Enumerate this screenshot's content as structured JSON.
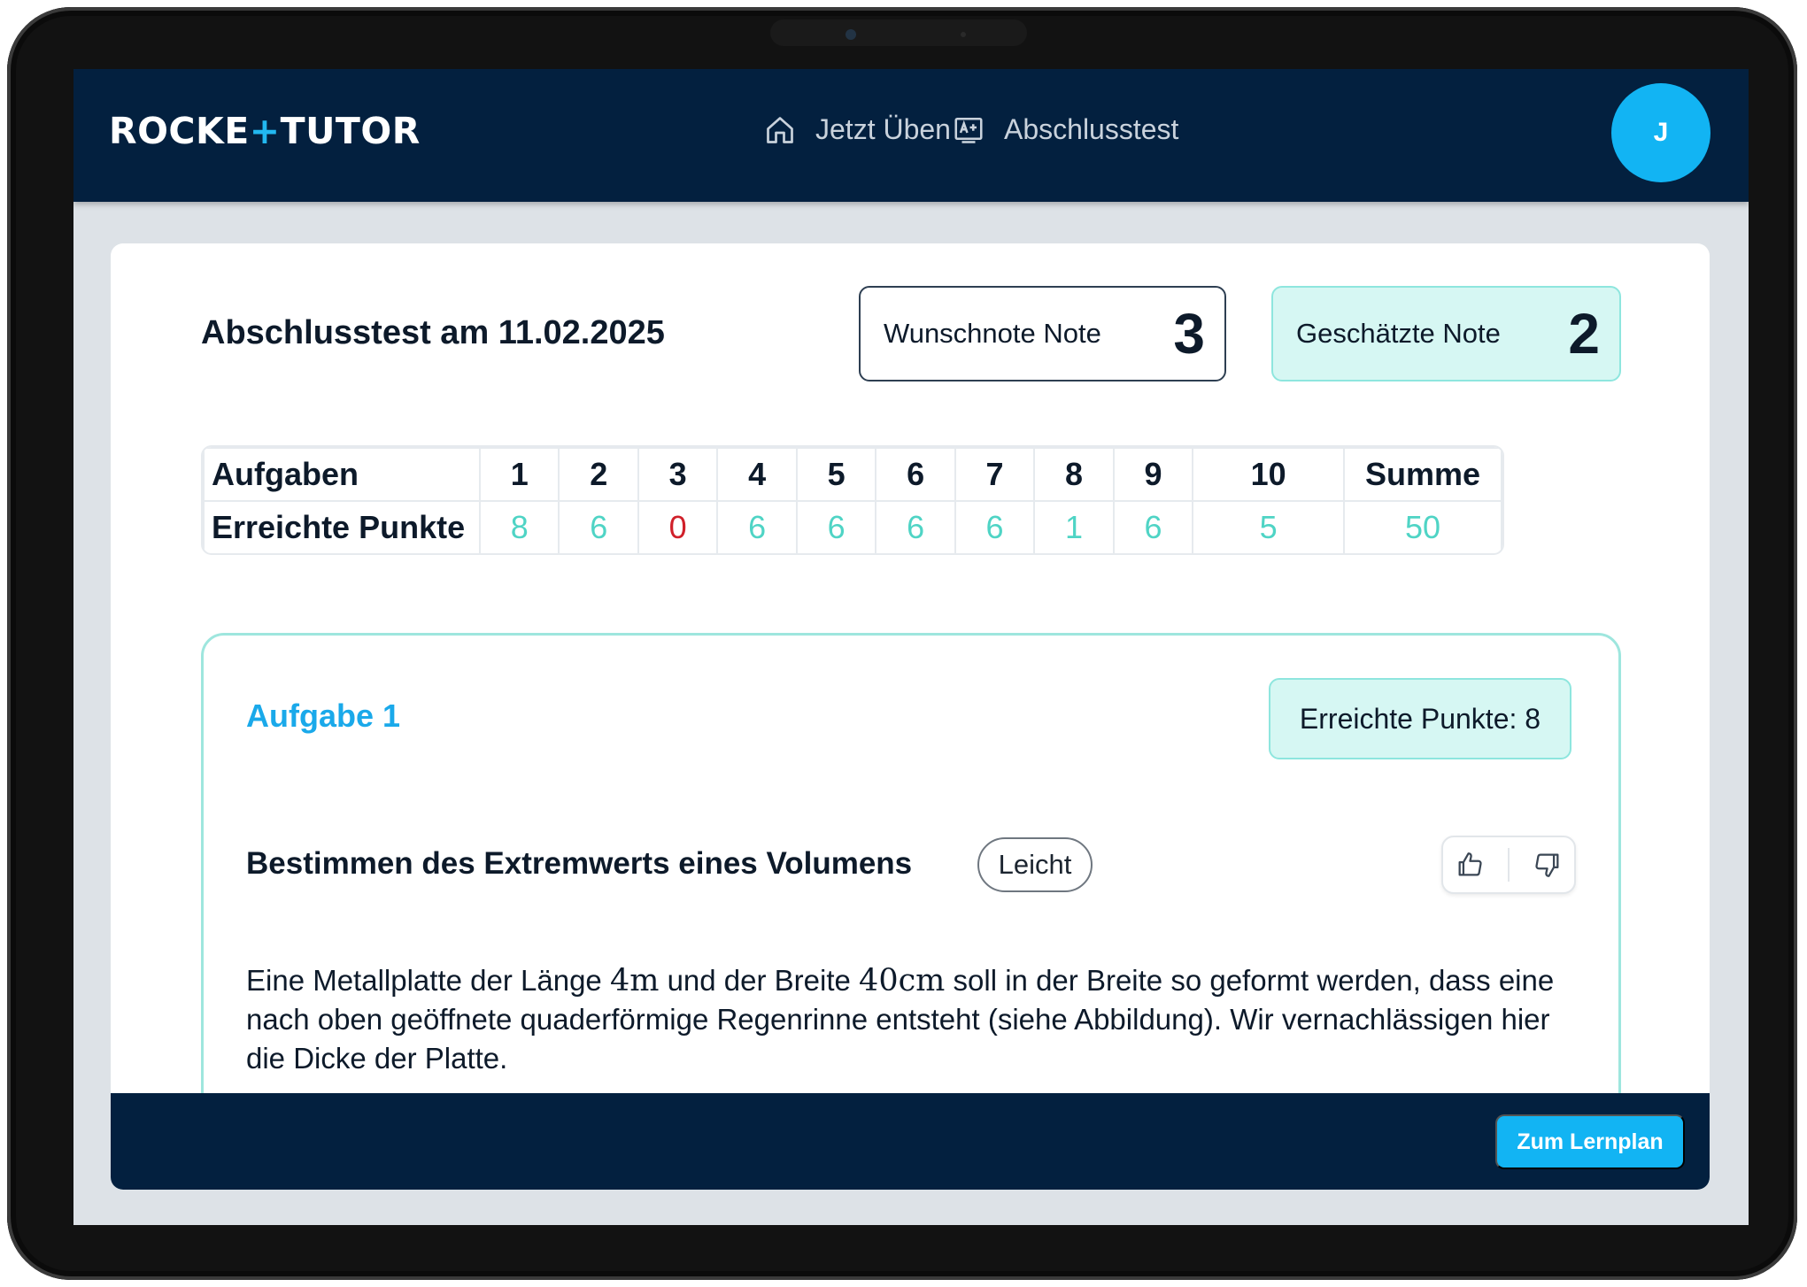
{
  "app": {
    "logo_part1": "ROCKE",
    "logo_plus": "+",
    "logo_part2": "TUTOR"
  },
  "nav": {
    "practice_label": "Jetzt Üben",
    "practice_icon": "home-icon",
    "final_test_label": "Abschlusstest",
    "final_test_icon": "grade-certificate-icon",
    "avatar_initial": "J"
  },
  "test": {
    "title": "Abschlusstest am 11.02.2025",
    "wish_grade_label": "Wunschnote Note",
    "wish_grade_value": "3",
    "estimated_grade_label": "Geschätzte Note",
    "estimated_grade_value": "2"
  },
  "score_table": {
    "row1_label": "Aufgaben",
    "row2_label": "Erreichte Punkte",
    "tasks": [
      {
        "number": "1",
        "points": "8"
      },
      {
        "number": "2",
        "points": "6"
      },
      {
        "number": "3",
        "points": "0"
      },
      {
        "number": "4",
        "points": "6"
      },
      {
        "number": "5",
        "points": "6"
      },
      {
        "number": "6",
        "points": "6"
      },
      {
        "number": "7",
        "points": "6"
      },
      {
        "number": "8",
        "points": "1"
      },
      {
        "number": "9",
        "points": "6"
      },
      {
        "number": "10",
        "points": "5"
      }
    ],
    "sum_label": "Summe",
    "sum_value": "50",
    "colors": {
      "positive": "#4fd4c5",
      "zero": "#d0202a"
    }
  },
  "task": {
    "title": "Aufgabe 1",
    "points_label": "Erreichte Punkte: 8",
    "heading": "Bestimmen des Extremwerts eines Volumens",
    "difficulty": "Leicht",
    "feedback_icons": [
      "thumbs-up-icon",
      "thumbs-down-icon"
    ],
    "text_part1": "Eine Metallplatte der Länge ",
    "math_length": "4m",
    "text_part2": " und der Breite ",
    "math_width": "40cm",
    "text_part3": " soll in der Breite so geformt werden, dass eine nach oben geöffnete quaderförmige Regenrinne entsteht (siehe Abbildung). Wir vernachlässigen hier die Dicke der Platte."
  },
  "footer": {
    "cta_label": "Zum Lernplan"
  },
  "theme": {
    "navy": "#03203f",
    "accent_blue": "#12b4f3",
    "mint": "#d6f7f3"
  }
}
